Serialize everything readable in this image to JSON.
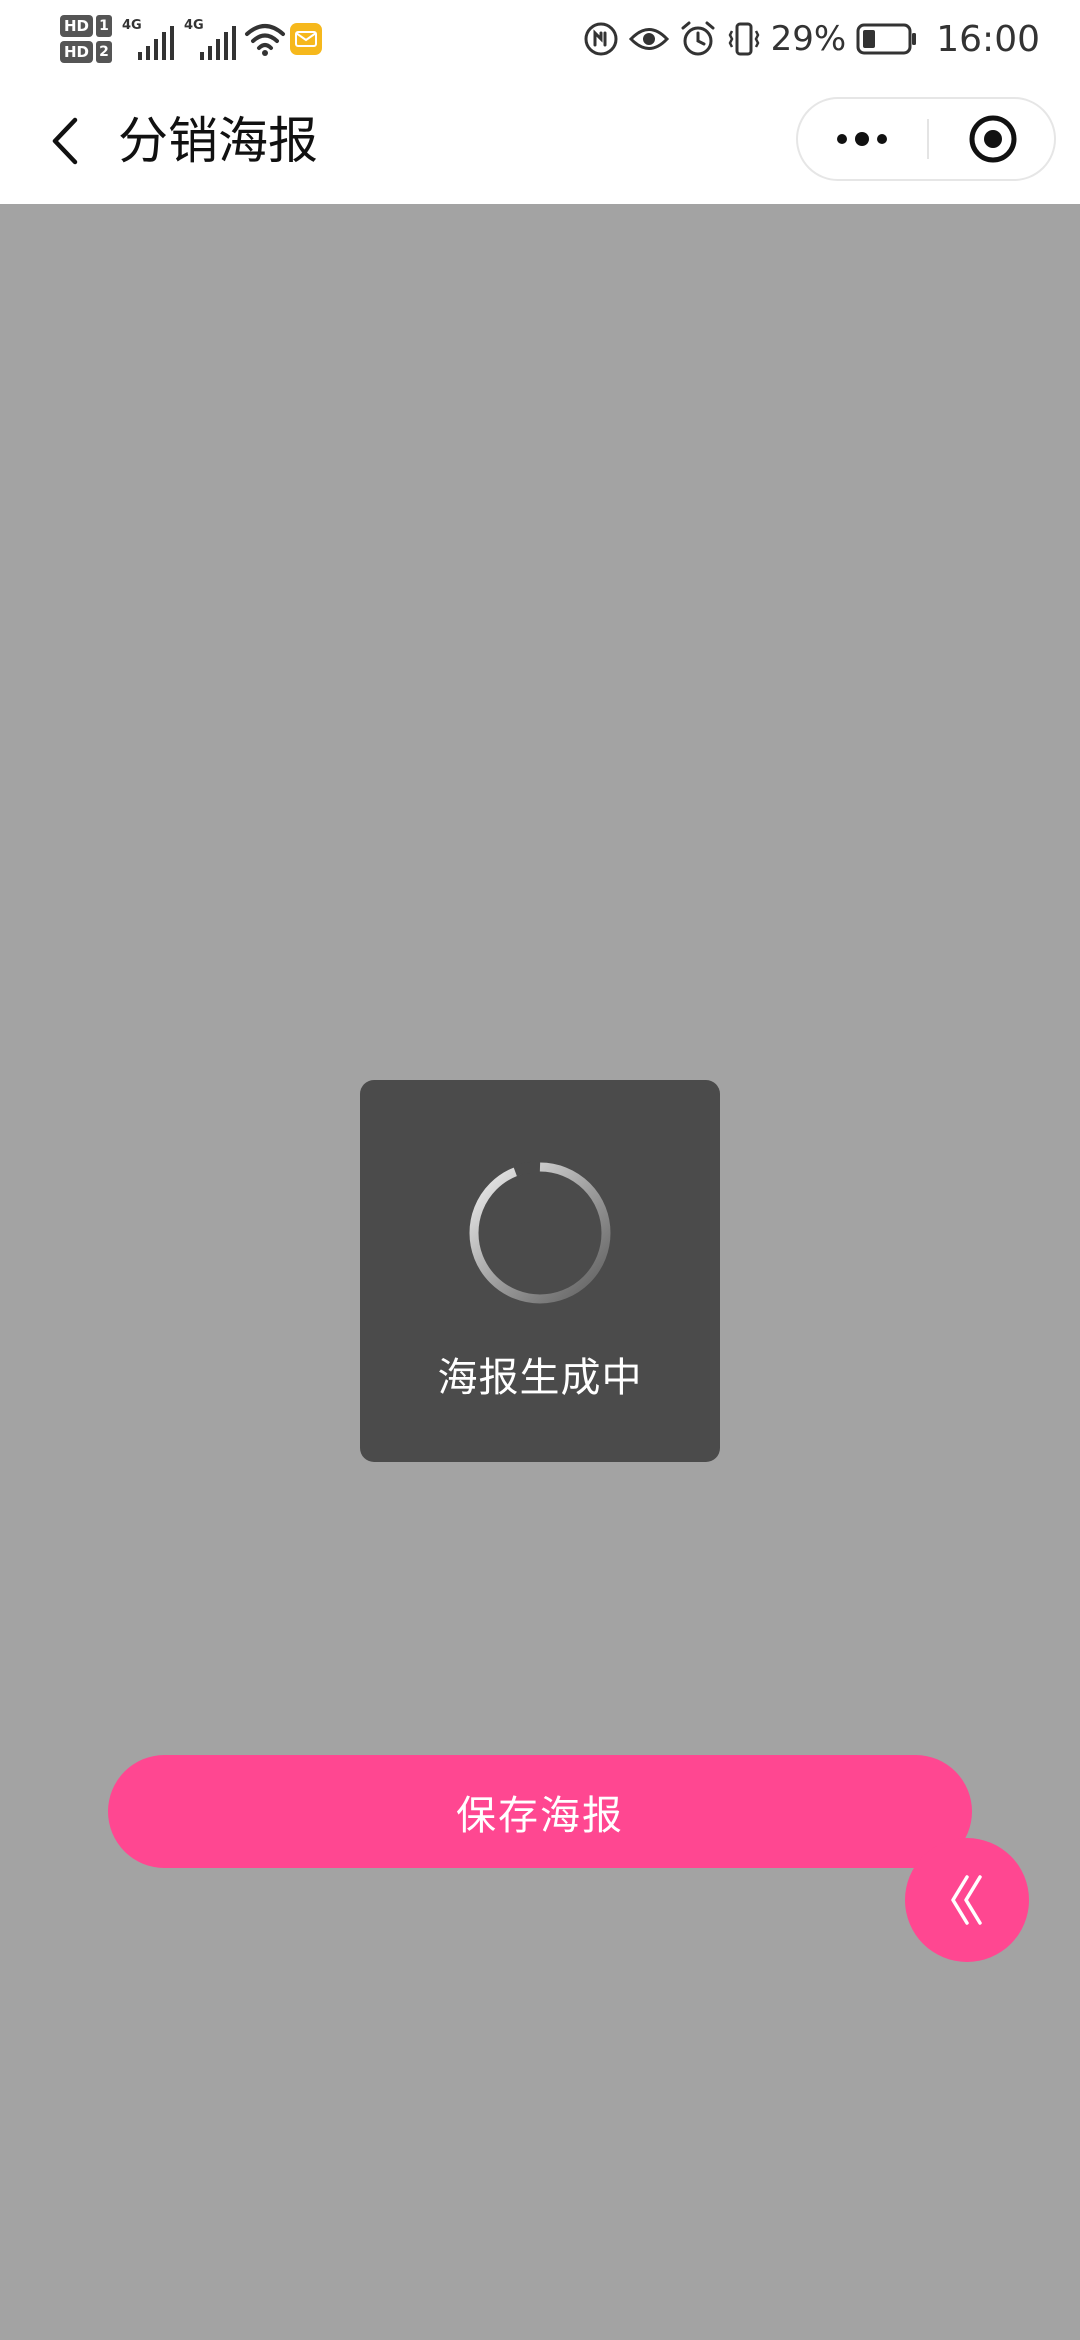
{
  "status_bar": {
    "sim1_label": "HD",
    "sim1_num": "1",
    "sim2_label": "HD",
    "sim2_num": "2",
    "network1": "4G",
    "network2": "4G",
    "battery_percent": "29%",
    "battery_level": 0.29,
    "time": "16:00",
    "icons": [
      "signal-icon",
      "wifi-icon",
      "mail-notification-icon",
      "nfc-icon",
      "eye-icon",
      "alarm-icon",
      "vibrate-icon",
      "battery-icon"
    ]
  },
  "nav": {
    "title": "分销海报",
    "back_icon": "chevron-left-icon",
    "more_icon": "more-dots-icon",
    "close_icon": "target-close-icon"
  },
  "toast": {
    "text": "海报生成中"
  },
  "actions": {
    "save_label": "保存海报",
    "collapse_icon": "double-chevron-left-icon"
  },
  "colors": {
    "accent": "#ff4791",
    "overlay": "#a3a3a3",
    "toast_bg": "#4b4b4b"
  }
}
